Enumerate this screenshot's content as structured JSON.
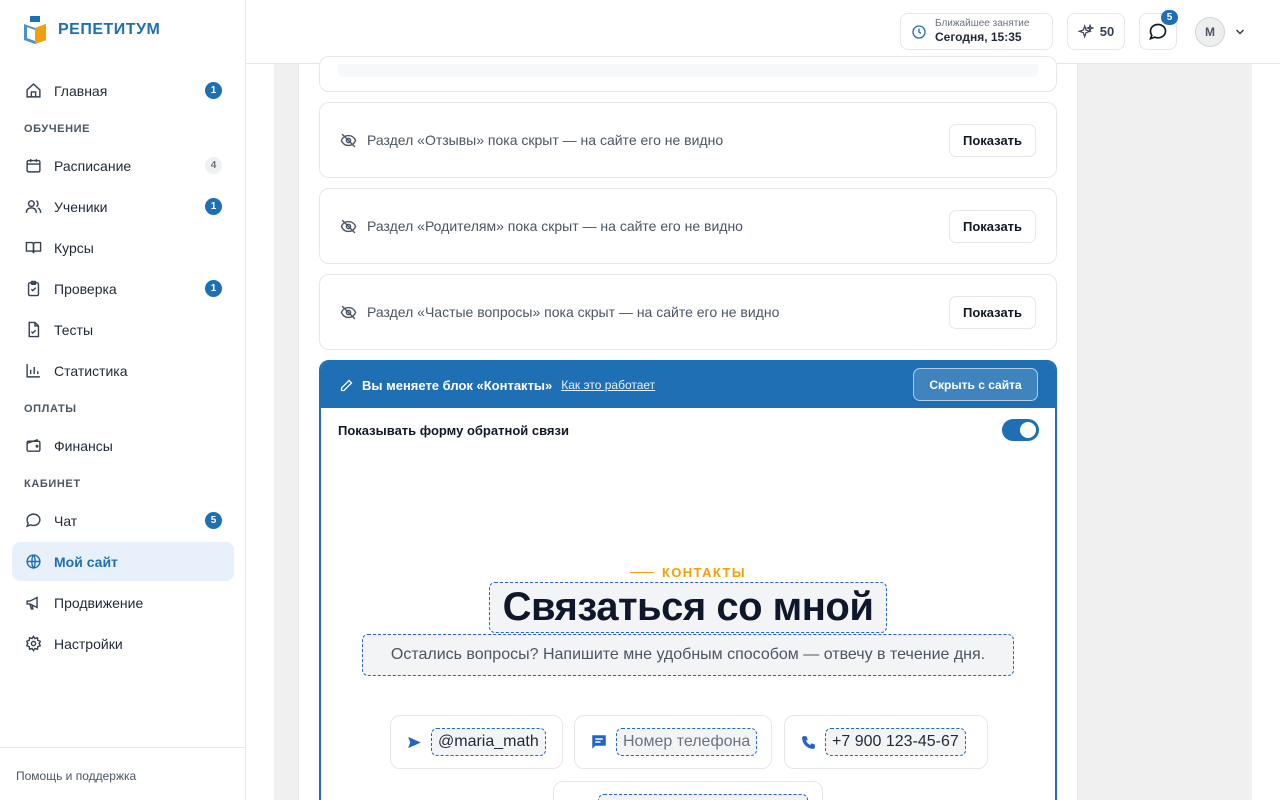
{
  "brand": {
    "name": "РЕПЕТИТУМ"
  },
  "sidebar": {
    "home": {
      "label": "Главная",
      "badge": "1"
    },
    "sections": [
      {
        "title": "ОБУЧЕНИЕ"
      },
      {
        "title": "ОПЛАТЫ"
      },
      {
        "title": "КАБИНЕТ"
      }
    ],
    "items": [
      {
        "label": "Расписание",
        "badge": "4",
        "icon": "calendar-icon"
      },
      {
        "label": "Ученики",
        "badge": "1",
        "icon": "users-icon"
      },
      {
        "label": "Курсы",
        "badge": "",
        "icon": "book-icon"
      },
      {
        "label": "Проверка",
        "badge": "1",
        "icon": "clipboard-icon"
      },
      {
        "label": "Тесты",
        "badge": "",
        "icon": "test-icon"
      },
      {
        "label": "Статистика",
        "badge": "",
        "icon": "chart-icon"
      },
      {
        "label": "Финансы",
        "badge": "",
        "icon": "wallet-icon"
      },
      {
        "label": "Чат",
        "badge": "5",
        "icon": "chat-icon"
      },
      {
        "label": "Мой сайт",
        "badge": "",
        "icon": "globe-icon"
      },
      {
        "label": "Продвижение",
        "badge": "",
        "icon": "megaphone-icon"
      },
      {
        "label": "Настройки",
        "badge": "",
        "icon": "gear-icon"
      }
    ],
    "help": "Помощь и поддержка"
  },
  "header": {
    "next_lesson_label": "Ближайшее занятие",
    "next_lesson_value": "Сегодня, 15:35",
    "points": "50",
    "chat_badge": "5",
    "avatar_initial": "М"
  },
  "hidden_sections": [
    {
      "text": "Раздел «Отзывы» пока скрыт — на сайте его не видно",
      "button": "Показать"
    },
    {
      "text": "Раздел «Родителям» пока скрыт — на сайте его не видно",
      "button": "Показать"
    },
    {
      "text": "Раздел «Частые вопросы» пока скрыт — на сайте его не видно",
      "button": "Показать"
    }
  ],
  "edit_block": {
    "title": "Вы меняете блок «Контакты»",
    "how_link": "Как это работает",
    "hide_button": "Скрыть с сайта",
    "toggle_label": "Показывать форму обратной связи",
    "toggle_on": true,
    "eyebrow": "КОНТАКТЫ",
    "headline": "Связаться со мной",
    "subtitle": "Остались вопросы? Напишите мне удобным способом — отвечу в течение дня.",
    "contacts": [
      {
        "icon": "telegram-icon",
        "value": "@maria_math"
      },
      {
        "icon": "message-icon",
        "value": "Номер телефона"
      },
      {
        "icon": "phone-icon",
        "value": "+7 900 123-45-67"
      }
    ]
  },
  "colors": {
    "accent": "#1e6fb4",
    "eyebrow": "#f59e0b"
  }
}
